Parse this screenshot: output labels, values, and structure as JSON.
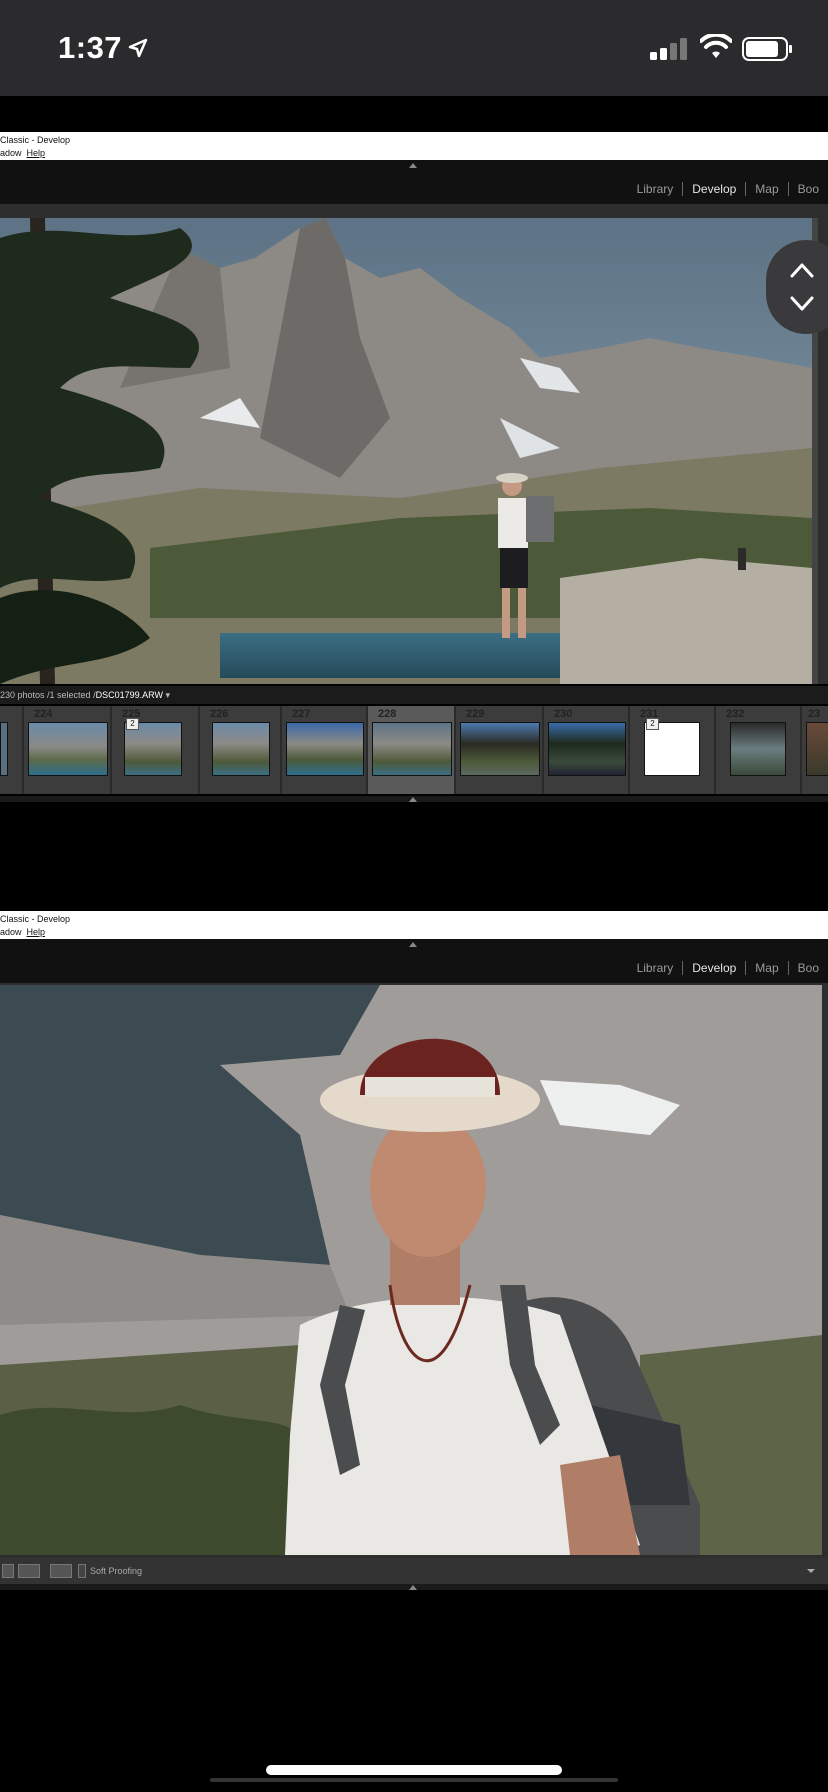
{
  "status_bar": {
    "time": "1:37",
    "icons": [
      "location-arrow-icon",
      "cellular-signal-icon",
      "wifi-icon",
      "battery-icon"
    ]
  },
  "top_panel": {
    "window_title": "Classic - Develop",
    "menu_text": "adow",
    "menu_help": "Help",
    "modules": [
      "Library",
      "Develop",
      "Map",
      "Boo"
    ],
    "active_module": "Develop",
    "info_prefix": "230 photos /1 selected /",
    "info_file": "DSC01799.ARW",
    "filmstrip": [
      {
        "num": "",
        "badge": ""
      },
      {
        "num": "224",
        "badge": ""
      },
      {
        "num": "225",
        "badge": "2"
      },
      {
        "num": "226",
        "badge": ""
      },
      {
        "num": "227",
        "badge": ""
      },
      {
        "num": "228",
        "badge": ""
      },
      {
        "num": "229",
        "badge": ""
      },
      {
        "num": "230",
        "badge": ""
      },
      {
        "num": "231",
        "badge": "2"
      },
      {
        "num": "232",
        "badge": ""
      },
      {
        "num": "23",
        "badge": ""
      }
    ],
    "selected_frame": "228"
  },
  "bottom_panel": {
    "window_title": "Classic - Develop",
    "menu_text": "adow",
    "menu_help": "Help",
    "modules": [
      "Library",
      "Develop",
      "Map",
      "Boo"
    ],
    "active_module": "Develop",
    "toolbar_soft_proofing": "Soft Proofing"
  },
  "colors": {
    "status_bar_bg": "#2b2b2d",
    "lr_bg": "#1a1a1a",
    "filmstrip_bg": "#2a2a2a"
  }
}
